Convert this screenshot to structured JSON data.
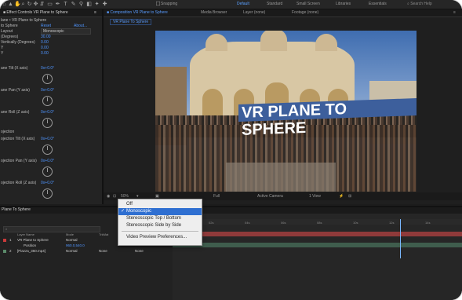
{
  "toolbar": {
    "icons": [
      "home-icon",
      "select-icon",
      "hand-icon",
      "zoom-icon",
      "orbit-icon",
      "pan-icon",
      "dolly-icon",
      "rectangle-icon",
      "pen-icon",
      "type-icon",
      "brush-icon",
      "clone-icon",
      "eraser-icon",
      "roto-icon",
      "puppet-icon"
    ],
    "snapping_label": "Snapping",
    "workspaces": [
      "Default",
      "Standard",
      "Small Screen",
      "Libraries",
      "Essentials"
    ],
    "search_placeholder": "Search Help"
  },
  "effect_controls": {
    "tab_label": "Effect Controls VR Plane to Sphere",
    "layer_label": "lane • VR Plane to Sphere",
    "effect_name": "to Sphere",
    "reset_label": "Reset",
    "about_label": "About...",
    "rows": [
      {
        "label": "Layout",
        "value": "Monoscopic"
      },
      {
        "label": "(Degrees)",
        "value": "30.00"
      },
      {
        "label": "Vertically (Degrees)",
        "value": "0.00"
      },
      {
        "label": "Y",
        "value": "0.00"
      },
      {
        "label": "Y",
        "value": "0.00"
      },
      {
        "label": "",
        "value": ""
      },
      {
        "label": "ane Tilt (X axis)",
        "value": "0x+0.0°"
      },
      {
        "label": "ane Pan (Y axis)",
        "value": "0x+0.0°"
      },
      {
        "label": "ane Roll (Z axis)",
        "value": "0x+0.0°"
      },
      {
        "label": "ojection",
        "value": ""
      },
      {
        "label": "ojection Tilt (X axis)",
        "value": "0x+0.0°"
      },
      {
        "label": "ojection Pan (Y axis)",
        "value": "0x+0.0°"
      },
      {
        "label": "ojection Roll (Z axis)",
        "value": "0x+0.0°"
      }
    ]
  },
  "composition": {
    "tabs": [
      {
        "label": "Composition VR Plane to Sphere",
        "active": true
      },
      {
        "label": "Media Browser",
        "active": false
      },
      {
        "label": "Layer (none)",
        "active": false
      },
      {
        "label": "Footage (none)",
        "active": false
      }
    ],
    "breadcrumb": "VR Plane To Sphere",
    "overlay_text": "VR PLANE TO SPHERE",
    "viewer_controls": [
      "50%",
      "Full",
      "Active Camera",
      "1 View"
    ]
  },
  "menu": {
    "items": [
      {
        "label": "Off",
        "checked": false,
        "selected": false
      },
      {
        "label": "Monoscopic",
        "checked": true,
        "selected": true
      },
      {
        "label": "Stereoscopic Top / Bottom",
        "checked": false,
        "selected": false
      },
      {
        "label": "Stereoscopic Side by Side",
        "checked": false,
        "selected": false
      },
      {
        "label": "Video Preview Preferences...",
        "checked": false,
        "selected": false
      }
    ]
  },
  "timeline": {
    "tab_label": "Plane To Sphere",
    "search_placeholder": "",
    "columns": [
      "Layer Name",
      "Mode",
      "TrkMat"
    ],
    "layers": [
      {
        "num": "1",
        "name": "VR Plane to Sphere",
        "mode": "Normal",
        "trkmat": "",
        "color": "#c93a3a"
      },
      {
        "num": "",
        "name": "Position",
        "mode": "960.0,540.0",
        "trkmat": "",
        "color": ""
      },
      {
        "num": "2",
        "name": "[Piazza_360.mp4]",
        "mode": "Normal",
        "trkmat": "None",
        "color": "#5a8a6a"
      }
    ],
    "time_ticks": [
      "00s",
      "02s",
      "04s",
      "06s",
      "08s",
      "10s",
      "12s",
      "14s"
    ]
  },
  "colors": {
    "accent_blue": "#2f6fd1",
    "link_blue": "#4f95ff",
    "layer_red": "#b83a3a"
  }
}
